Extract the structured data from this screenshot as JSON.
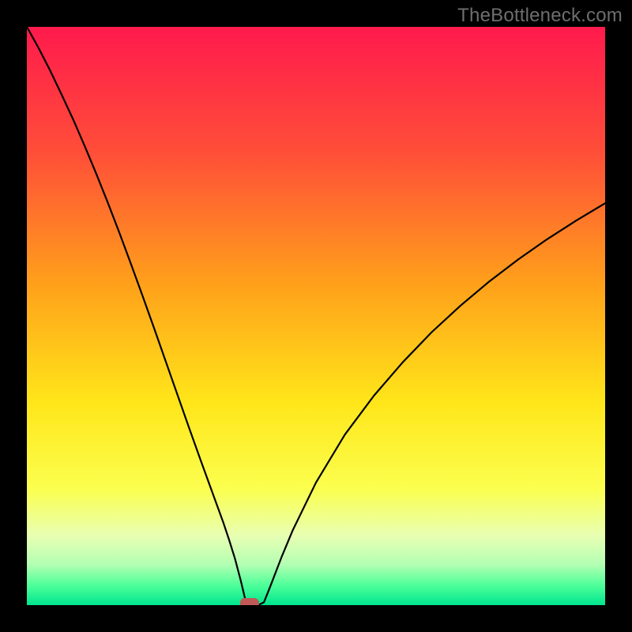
{
  "watermark": "TheBottleneck.com",
  "chart_data": {
    "type": "line",
    "title": "",
    "xlabel": "",
    "ylabel": "",
    "xlim": [
      0,
      100
    ],
    "ylim": [
      0,
      100
    ],
    "grid": false,
    "legend": false,
    "series": [
      {
        "name": "bottleneck-curve",
        "x": [
          0,
          2,
          4,
          6,
          8,
          10,
          12,
          14,
          16,
          18,
          20,
          22,
          24,
          26,
          28,
          30,
          32,
          34,
          35,
          36,
          37,
          38,
          39,
          40,
          41,
          42,
          44,
          46,
          50,
          55,
          60,
          65,
          70,
          75,
          80,
          85,
          90,
          95,
          100
        ],
        "y": [
          100,
          96.4,
          92.5,
          88.3,
          84.0,
          79.4,
          74.6,
          69.6,
          64.4,
          59.0,
          53.5,
          47.9,
          42.2,
          36.5,
          30.8,
          25.2,
          19.7,
          14.2,
          11.2,
          8.0,
          4.2,
          0.0,
          0.0,
          0.0,
          0.5,
          3.0,
          8.2,
          13.0,
          21.2,
          29.5,
          36.2,
          42.0,
          47.2,
          51.8,
          56.0,
          59.8,
          63.3,
          66.5,
          69.5
        ]
      }
    ],
    "marker": {
      "name": "optimal-point",
      "x": 38.5,
      "y": 0,
      "color": "#c05a57"
    },
    "background_gradient": {
      "stops": [
        {
          "offset": 0.0,
          "color": "#ff1a4d"
        },
        {
          "offset": 0.22,
          "color": "#ff4f38"
        },
        {
          "offset": 0.45,
          "color": "#ffa21a"
        },
        {
          "offset": 0.65,
          "color": "#ffe61a"
        },
        {
          "offset": 0.8,
          "color": "#fbff4f"
        },
        {
          "offset": 0.88,
          "color": "#e8ffb3"
        },
        {
          "offset": 0.93,
          "color": "#b3ffb3"
        },
        {
          "offset": 0.965,
          "color": "#4fff99"
        },
        {
          "offset": 1.0,
          "color": "#00e58f"
        }
      ]
    }
  }
}
